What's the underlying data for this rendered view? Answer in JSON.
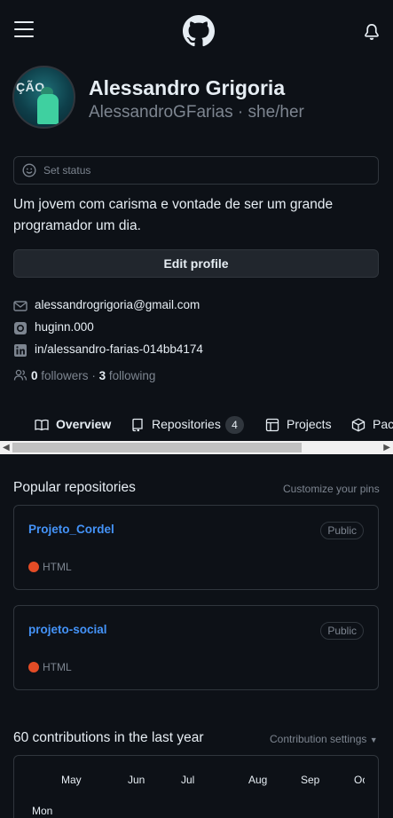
{
  "header": {
    "menu_icon": "hamburger-icon",
    "logo_icon": "github-logo-icon",
    "notifications_icon": "bell-icon"
  },
  "profile": {
    "avatar_text": "ÇÃO",
    "name": "Alessandro Grigoria",
    "login_line": "AlessandroGFarias · she/her",
    "status_placeholder": "Set status",
    "bio": "Um jovem com carisma e vontade de ser um grande programador um dia.",
    "edit_label": "Edit profile",
    "email": "alessandrogrigoria@gmail.com",
    "instagram": "huginn.000",
    "linkedin": "in/alessandro-farias-014bb4174",
    "followers_count": "0",
    "followers_label": "followers",
    "separator": "·",
    "following_count": "3",
    "following_label": "following"
  },
  "tabs": [
    {
      "label": "Overview",
      "icon": "book-icon",
      "active": true
    },
    {
      "label": "Repositories",
      "icon": "repo-icon",
      "count": "4"
    },
    {
      "label": "Projects",
      "icon": "table-icon"
    },
    {
      "label": "Packages",
      "icon": "package-icon"
    }
  ],
  "popular": {
    "title": "Popular repositories",
    "customize_label": "Customize your pins",
    "repos": [
      {
        "name": "Projeto_Cordel",
        "visibility": "Public",
        "language": "HTML",
        "language_color": "#e34c26"
      },
      {
        "name": "projeto-social",
        "visibility": "Public",
        "language": "HTML",
        "language_color": "#e34c26"
      }
    ]
  },
  "contributions": {
    "title": "60 contributions in the last year",
    "settings_label": "Contribution settings",
    "months": [
      "May",
      "Jun",
      "Jul",
      "Aug",
      "Sep",
      "Oct"
    ],
    "weekday": "Mon"
  },
  "colors": {
    "background": "#0d1117",
    "border": "#30363d",
    "link": "#4493f8",
    "muted": "#7d8590"
  }
}
